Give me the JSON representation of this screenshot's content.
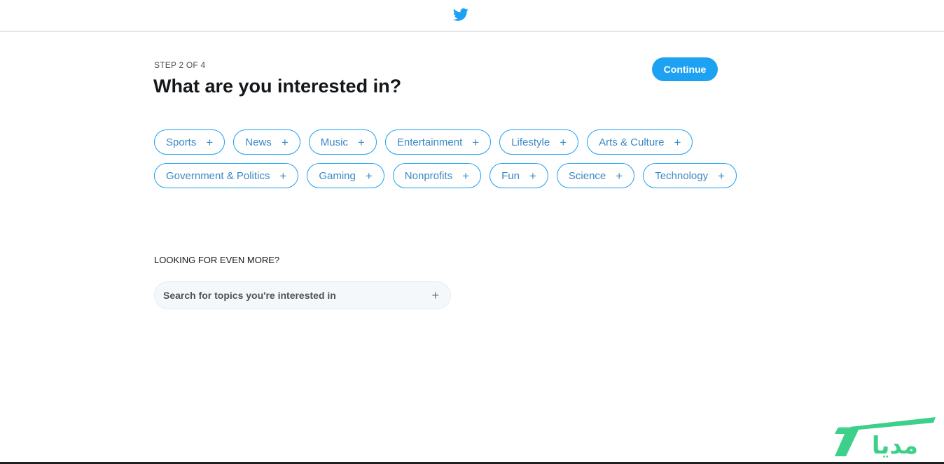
{
  "header": {
    "logo_icon": "twitter-bird-icon",
    "logo_color": "#1da1f2"
  },
  "onboarding": {
    "step": "STEP 2 OF 4",
    "title": "What are you interested in?",
    "continue_label": "Continue"
  },
  "topics": {
    "row1": [
      {
        "label": "Sports"
      },
      {
        "label": "News"
      },
      {
        "label": "Music"
      },
      {
        "label": "Entertainment"
      },
      {
        "label": "Lifestyle"
      },
      {
        "label": "Arts & Culture"
      }
    ],
    "row2": [
      {
        "label": "Government & Politics"
      },
      {
        "label": "Gaming"
      },
      {
        "label": "Nonprofits"
      },
      {
        "label": "Fun"
      },
      {
        "label": "Science"
      },
      {
        "label": "Technology"
      }
    ],
    "add_glyph": "+"
  },
  "more": {
    "label": "LOOKING FOR EVEN MORE?",
    "search_placeholder": "Search for topics you're interested in",
    "search_add_glyph": "+"
  },
  "watermark": {
    "text": "مدیا",
    "color": "#3dd08a"
  },
  "colors": {
    "accent": "#1da1f2",
    "chip_text": "#3b88c4"
  }
}
